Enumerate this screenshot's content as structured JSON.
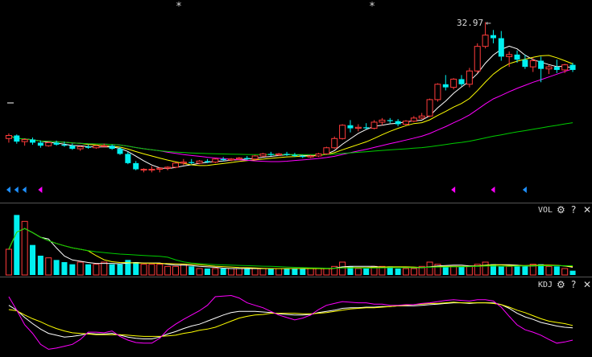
{
  "colors": {
    "background": "#000000",
    "up": "#ff3b3b",
    "down": "#00f0f0",
    "separator": "#555555",
    "ma5": "#ffffff",
    "ma10": "#ffff00",
    "ma20": "#ff00ff",
    "ma60": "#00cc00",
    "k_line": "#ffffff",
    "d_line": "#ffff00",
    "j_line": "#ff00ff",
    "buy_marker": "#1e90ff",
    "sell_marker": "#ff00ff"
  },
  "main_panel": {
    "max_price_label": "32.97",
    "max_price_arrow": "←",
    "star_markers": [
      "*",
      "*"
    ]
  },
  "volume_panel": {
    "title": "VOL",
    "settings_icon": "gear-icon",
    "help_icon": "?",
    "close_icon": "✕"
  },
  "kdj_panel": {
    "title": "KDJ",
    "settings_icon": "gear-icon",
    "help_icon": "?",
    "close_icon": "✕"
  },
  "chart_data": [
    {
      "type": "candlestick",
      "title": "",
      "candles": [
        [
          21.6,
          22.1,
          21.2,
          21.9
        ],
        [
          21.9,
          22.0,
          21.1,
          21.3
        ],
        [
          21.3,
          21.6,
          20.9,
          21.5
        ],
        [
          21.5,
          21.7,
          21.0,
          21.2
        ],
        [
          21.2,
          21.4,
          20.7,
          20.9
        ],
        [
          20.9,
          21.3,
          20.8,
          21.2
        ],
        [
          21.2,
          21.4,
          20.9,
          21.0
        ],
        [
          21.0,
          21.3,
          20.8,
          20.9
        ],
        [
          20.9,
          21.1,
          20.5,
          20.6
        ],
        [
          20.6,
          20.9,
          20.4,
          20.8
        ],
        [
          20.8,
          21.0,
          20.6,
          20.7
        ],
        [
          20.7,
          21.0,
          20.6,
          20.9
        ],
        [
          20.9,
          21.1,
          20.8,
          20.9
        ],
        [
          20.9,
          21.0,
          20.5,
          20.6
        ],
        [
          20.6,
          20.8,
          20.0,
          20.1
        ],
        [
          20.1,
          20.3,
          19.1,
          19.2
        ],
        [
          19.2,
          19.4,
          18.5,
          18.6
        ],
        [
          18.6,
          18.7,
          18.3,
          18.6
        ],
        [
          18.6,
          18.9,
          18.3,
          18.6
        ],
        [
          18.6,
          18.8,
          18.3,
          18.7
        ],
        [
          18.7,
          18.9,
          18.5,
          18.8
        ],
        [
          18.8,
          19.3,
          18.7,
          19.2
        ],
        [
          19.2,
          19.6,
          19.0,
          19.3
        ],
        [
          19.3,
          19.6,
          19.1,
          19.2
        ],
        [
          19.2,
          19.5,
          19.1,
          19.4
        ],
        [
          19.4,
          19.6,
          19.2,
          19.3
        ],
        [
          19.3,
          19.7,
          19.2,
          19.6
        ],
        [
          19.6,
          19.8,
          19.4,
          19.5
        ],
        [
          19.5,
          19.7,
          19.4,
          19.6
        ],
        [
          19.6,
          19.8,
          19.5,
          19.7
        ],
        [
          19.7,
          19.9,
          19.5,
          19.6
        ],
        [
          19.6,
          20.0,
          19.5,
          19.9
        ],
        [
          19.9,
          20.2,
          19.8,
          20.1
        ],
        [
          20.1,
          20.3,
          19.9,
          20.0
        ],
        [
          20.0,
          20.2,
          19.9,
          20.1
        ],
        [
          20.1,
          20.3,
          19.9,
          20.0
        ],
        [
          20.0,
          20.2,
          19.8,
          19.9
        ],
        [
          19.9,
          20.0,
          19.7,
          19.8
        ],
        [
          19.8,
          20.0,
          19.7,
          19.9
        ],
        [
          19.9,
          20.2,
          19.8,
          20.1
        ],
        [
          20.1,
          20.8,
          20.0,
          20.7
        ],
        [
          20.7,
          21.8,
          20.6,
          21.6
        ],
        [
          21.6,
          23.0,
          21.5,
          22.9
        ],
        [
          22.9,
          23.4,
          22.2,
          22.6
        ],
        [
          22.6,
          23.0,
          22.3,
          22.7
        ],
        [
          22.7,
          23.1,
          22.5,
          22.6
        ],
        [
          22.6,
          23.4,
          22.5,
          23.2
        ],
        [
          23.2,
          23.6,
          22.9,
          23.4
        ],
        [
          23.4,
          23.6,
          23.1,
          23.3
        ],
        [
          23.3,
          23.5,
          22.8,
          23.0
        ],
        [
          23.0,
          23.4,
          22.9,
          23.3
        ],
        [
          23.3,
          23.8,
          23.2,
          23.6
        ],
        [
          23.6,
          24.1,
          23.5,
          23.8
        ],
        [
          23.8,
          25.5,
          23.7,
          25.4
        ],
        [
          25.4,
          27.0,
          25.2,
          26.9
        ],
        [
          26.9,
          27.8,
          26.3,
          26.6
        ],
        [
          26.6,
          27.5,
          26.4,
          27.4
        ],
        [
          27.4,
          27.8,
          26.7,
          26.9
        ],
        [
          26.9,
          28.5,
          26.6,
          28.2
        ],
        [
          28.2,
          30.9,
          28.0,
          30.6
        ],
        [
          30.6,
          32.97,
          30.4,
          31.7
        ],
        [
          31.7,
          32.2,
          30.9,
          31.4
        ],
        [
          31.4,
          32.1,
          29.2,
          29.6
        ],
        [
          29.6,
          30.1,
          28.6,
          29.8
        ],
        [
          29.8,
          30.2,
          29.0,
          29.3
        ],
        [
          29.3,
          29.8,
          28.4,
          28.6
        ],
        [
          28.6,
          29.5,
          28.1,
          29.2
        ],
        [
          29.2,
          29.6,
          27.1,
          28.4
        ],
        [
          28.4,
          28.8,
          27.9,
          28.6
        ],
        [
          28.6,
          29.3,
          28.0,
          28.3
        ],
        [
          28.3,
          28.9,
          28.0,
          28.8
        ],
        [
          28.8,
          29.0,
          28.1,
          28.3
        ]
      ],
      "ma_periods": [
        5,
        10,
        20,
        60
      ],
      "y_range": [
        15.5,
        34.5
      ]
    },
    {
      "type": "bar",
      "title": "VOL",
      "values": [
        12,
        28,
        25,
        14,
        9,
        8,
        7,
        6,
        5,
        6,
        5,
        5,
        6,
        5,
        5,
        7,
        6,
        5,
        5,
        5,
        4,
        4,
        5,
        4,
        3,
        3,
        3,
        3,
        3,
        3,
        3,
        3,
        3,
        3,
        3,
        3,
        3,
        3,
        3,
        3,
        3,
        4,
        6,
        4,
        3,
        3,
        4,
        4,
        4,
        3,
        3,
        3,
        4,
        6,
        5,
        4,
        4,
        4,
        4,
        5,
        6,
        5,
        4,
        4,
        4,
        4,
        5,
        5,
        4,
        4,
        3,
        2
      ],
      "y_range": [
        0,
        30
      ]
    },
    {
      "type": "line",
      "title": "KDJ",
      "series": [
        {
          "values": [
            82,
            74,
            62,
            52,
            43,
            36,
            33,
            30,
            31,
            33,
            36,
            35,
            35,
            36,
            33,
            30,
            28,
            27,
            27,
            30,
            35,
            39,
            44,
            48,
            51,
            56,
            61,
            66,
            70,
            72,
            72,
            72,
            71,
            70,
            68,
            67,
            66,
            66,
            67,
            70,
            72,
            74,
            77,
            78,
            78,
            79,
            79,
            80,
            80,
            81,
            81,
            81,
            82,
            83,
            84,
            85,
            86,
            86,
            85,
            86,
            86,
            86,
            83,
            77,
            69,
            63,
            59,
            54,
            51,
            48,
            46,
            45
          ]
        },
        {
          "values": [
            75,
            73,
            66,
            60,
            55,
            49,
            44,
            40,
            37,
            36,
            35,
            34,
            34,
            34,
            34,
            33,
            32,
            31,
            31,
            31,
            32,
            33,
            36,
            38,
            41,
            43,
            46,
            51,
            56,
            61,
            64,
            66,
            67,
            69,
            69,
            69,
            69,
            68,
            68,
            69,
            70,
            72,
            74,
            76,
            77,
            78,
            78,
            79,
            80,
            81,
            82,
            83,
            84,
            85,
            85,
            86,
            87,
            86,
            86,
            86,
            86,
            85,
            83,
            79,
            74,
            70,
            65,
            60,
            56,
            54,
            52,
            49
          ]
        },
        {
          "values": [
            96,
            74,
            50,
            36,
            18,
            10,
            12,
            15,
            18,
            26,
            38,
            38,
            37,
            40,
            31,
            25,
            21,
            20,
            20,
            28,
            42,
            51,
            59,
            66,
            73,
            82,
            96,
            97,
            98,
            94,
            86,
            82,
            78,
            72,
            66,
            62,
            58,
            61,
            66,
            75,
            82,
            85,
            88,
            87,
            86,
            86,
            84,
            84,
            82,
            82,
            83,
            83,
            85,
            86,
            88,
            90,
            91,
            90,
            89,
            91,
            91,
            89,
            79,
            64,
            50,
            42,
            38,
            33,
            26,
            20,
            22,
            25
          ]
        }
      ],
      "y_range": [
        0,
        100
      ]
    }
  ]
}
